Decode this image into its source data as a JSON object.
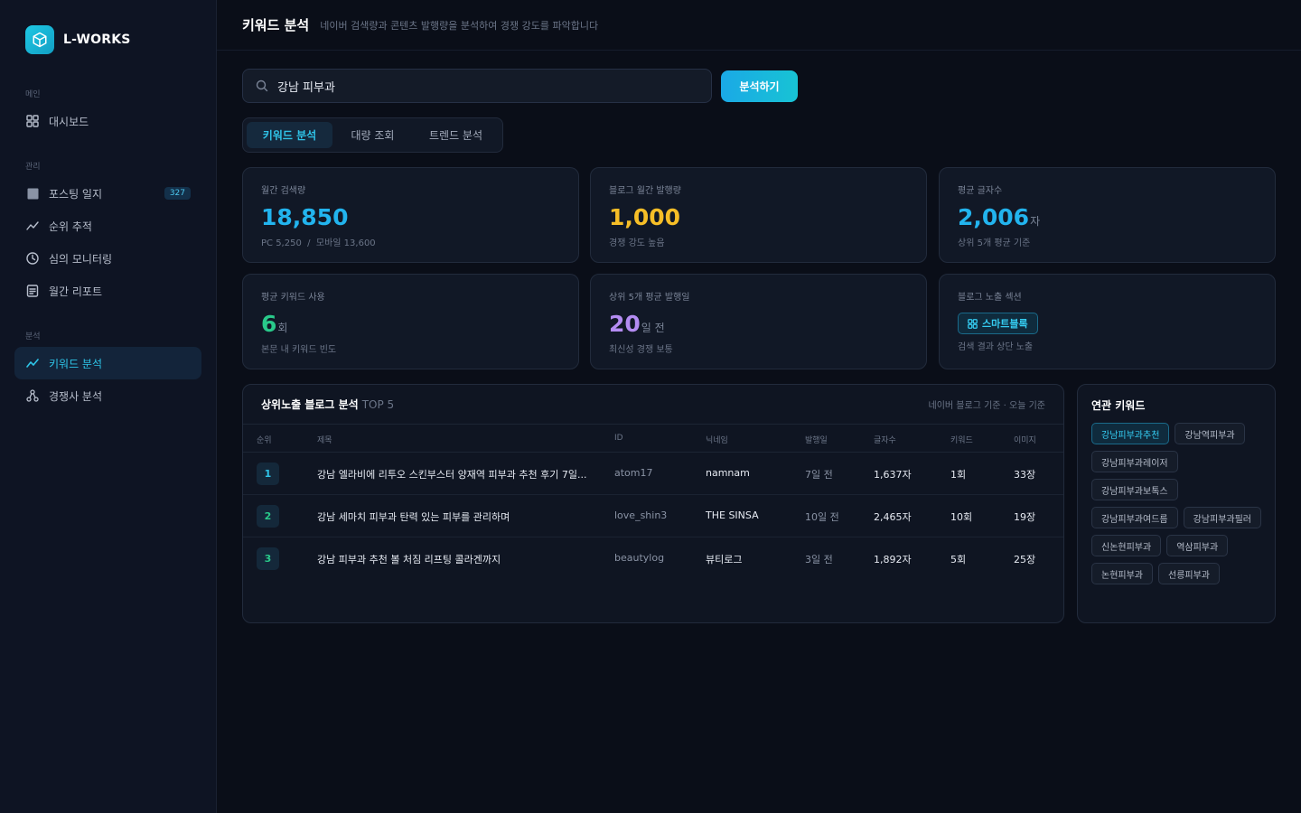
{
  "brand": {
    "name": "L-WORKS"
  },
  "sidebar": {
    "sections": [
      {
        "label": "메인"
      },
      {
        "label": "관리"
      },
      {
        "label": "분석"
      }
    ],
    "items": [
      {
        "label": "대시보드",
        "icon": "grid-icon"
      },
      {
        "label": "포스팅 일지",
        "icon": "square-icon",
        "badge": "327"
      },
      {
        "label": "순위 추적",
        "icon": "trend-icon"
      },
      {
        "label": "심의 모니터링",
        "icon": "clock-icon"
      },
      {
        "label": "월간 리포트",
        "icon": "document-icon"
      },
      {
        "label": "키워드 분석",
        "icon": "chart-line-icon",
        "active": true
      },
      {
        "label": "경쟁사 분석",
        "icon": "network-icon"
      }
    ]
  },
  "header": {
    "title": "키워드 분석",
    "subtitle": "네이버 검색량과 콘텐츠 발행량을 분석하여 경쟁 강도를 파악합니다"
  },
  "search": {
    "value": "강남 피부과",
    "button_label": "분석하기"
  },
  "tabs": [
    {
      "label": "키워드 분석",
      "active": true
    },
    {
      "label": "대량 조회"
    },
    {
      "label": "트렌드 분석"
    }
  ],
  "stats": [
    {
      "label": "월간 검색량",
      "value": "18,850",
      "unit": "",
      "sub": "PC 5,250  /  모바일 13,600",
      "color": "#22b4ee"
    },
    {
      "label": "블로그 월간 발행량",
      "value": "1,000",
      "unit": "",
      "sub": "경쟁 강도 높음",
      "color": "#f6be27"
    },
    {
      "label": "평균 글자수",
      "value": "2,006",
      "unit": "자",
      "sub": "상위 5개 평균 기준",
      "color": "#22b4ee"
    },
    {
      "label": "평균 키워드 사용",
      "value": "6",
      "unit": "회",
      "sub": "본문 내 키워드 빈도",
      "color": "#29c98a"
    },
    {
      "label": "상위 5개 평균 발행일",
      "value": "20",
      "unit": "일 전",
      "sub": "최신성 경쟁 보통",
      "color": "#b48cf2"
    },
    {
      "label": "블로그 노출 섹션",
      "chip": "스마트블록",
      "sub": "검색 결과 상단 노출"
    }
  ],
  "table": {
    "title": "상위노출 블로그 분석",
    "title_tag": "TOP 5",
    "meta": "네이버 블로그 기준 · 오늘 기준",
    "headers": [
      "순위",
      "제목",
      "ID",
      "닉네임",
      "발행일",
      "글자수",
      "키워드",
      "이미지"
    ],
    "rows": [
      {
        "rank": "1",
        "title": "강남 엘라비에 리투오 스킨부스터 양재역 피부과 추천 후기 7일...",
        "id": "atom17",
        "nickname": "namnam",
        "date": "7일 전",
        "chars": "1,637자",
        "keyword": "1회",
        "images": "33장"
      },
      {
        "rank": "2",
        "title": "강남 세마치 피부과 탄력 있는 피부를 관리하며",
        "id": "love_shin3",
        "nickname": "THE SINSA",
        "date": "10일 전",
        "chars": "2,465자",
        "keyword": "10회",
        "images": "19장"
      },
      {
        "rank": "3",
        "title": "강남 피부과 추천 볼 처짐 리프팅 콜라겐까지",
        "id": "beautylog",
        "nickname": "뷰티로그",
        "date": "3일 전",
        "chars": "1,892자",
        "keyword": "5회",
        "images": "25장"
      }
    ]
  },
  "related": {
    "title": "연관 키워드",
    "keywords": [
      {
        "label": "강남피부과추천",
        "active": true
      },
      {
        "label": "강남역피부과"
      },
      {
        "label": "강남피부과레이저"
      },
      {
        "label": "강남피부과보톡스"
      },
      {
        "label": "강남피부과여드름"
      },
      {
        "label": "강남피부과필러"
      },
      {
        "label": "신논현피부과"
      },
      {
        "label": "역삼피부과"
      },
      {
        "label": "논현피부과"
      },
      {
        "label": "선릉피부과"
      }
    ]
  },
  "colors": {
    "accent": "#22b4ee",
    "background": "#0a0e18",
    "sidebar": "#0e1423"
  }
}
